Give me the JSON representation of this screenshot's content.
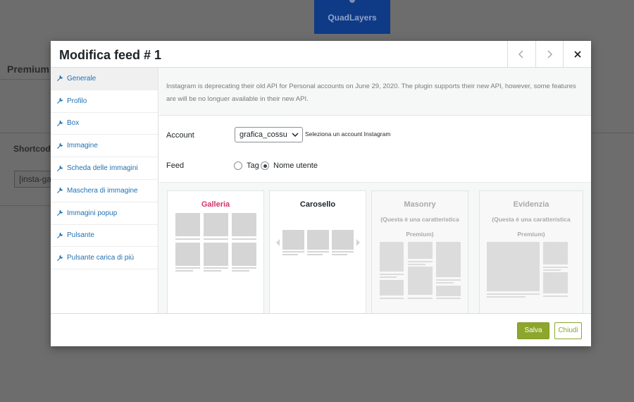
{
  "background": {
    "logo_text": "QuadLayers",
    "premium_label": "Premium",
    "shortcode_label": "Shortcode",
    "shortcode_value": "[insta-ga"
  },
  "modal": {
    "title": "Modifica feed # 1",
    "prev_icon": "chevron-left-icon",
    "next_icon": "chevron-right-icon",
    "close_icon": "close-icon"
  },
  "sidebar": {
    "items": [
      {
        "label": "Generale",
        "active": true
      },
      {
        "label": "Profilo"
      },
      {
        "label": "Box"
      },
      {
        "label": "Immagine"
      },
      {
        "label": "Scheda delle immagini"
      },
      {
        "label": "Maschera di immagine"
      },
      {
        "label": "Immagini popup"
      },
      {
        "label": "Pulsante"
      },
      {
        "label": "Pulsante carica di più"
      }
    ]
  },
  "notice": "Instagram is deprecating their old API for Personal accounts on June 29, 2020. The plugin supports their new API, however, some features are will be no longuer available in their new API.",
  "account": {
    "label": "Account",
    "selected": "grafica_cossu",
    "hint": "Seleziona un account Instagram"
  },
  "feed": {
    "label": "Feed",
    "options": [
      {
        "label": "Tag",
        "checked": false
      },
      {
        "label": "Nome utente",
        "checked": true
      }
    ]
  },
  "layouts": [
    {
      "title": "Galleria",
      "color": "#d63366",
      "premium": false
    },
    {
      "title": "Carosello",
      "color": "#1d2327",
      "premium": false
    },
    {
      "title": "Masonry",
      "color": "#a7aaad",
      "premium": true,
      "note": "(Questa è una caratteristica Premium)"
    },
    {
      "title": "Evidenzia",
      "color": "#a7aaad",
      "premium": true,
      "note": "(Questa è una caratteristica Premium)"
    }
  ],
  "footer": {
    "save_label": "Salva",
    "close_label": "Chiudi"
  },
  "colors": {
    "accent": "#8ca72c",
    "link": "#2271b1",
    "overlay": "#6d6d6d"
  }
}
